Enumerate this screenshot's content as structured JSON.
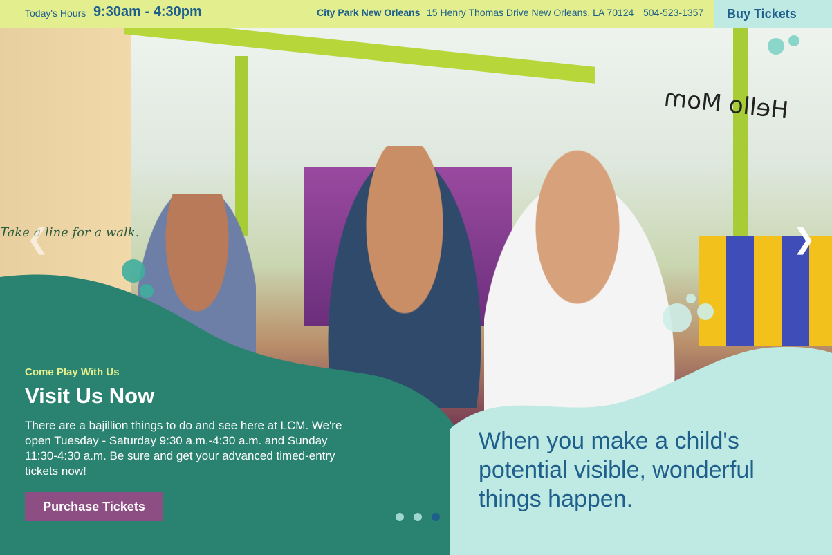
{
  "topbar": {
    "hours_label": "Today's Hours",
    "hours": "9:30am - 4:30pm",
    "location_name": "City Park New Orleans",
    "address": "15 Henry Thomas Drive New Orleans, LA 70124",
    "phone": "504-523-1357",
    "buy_label": "Buy Tickets"
  },
  "hero": {
    "photo_sign_text": "Take a line for a walk.",
    "photo_drawing_text": "Hello Mom",
    "eyebrow": "Come Play With Us",
    "title": "Visit Us Now",
    "description": "There are a bajillion things to do and see here at LCM. We're open Tuesday - Saturday 9:30 a.m.-4:30 a.m. and Sunday 11:30-4:30 a.m. Be sure and get your advanced timed-entry tickets now!",
    "purchase_label": "Purchase Tickets",
    "tagline": "When you make a child's potential visible, wonderful things happen.",
    "prev_icon": "chevron-left-icon",
    "next_icon": "chevron-right-icon",
    "slides": 3,
    "active_slide": 3
  },
  "colors": {
    "topbar_bg": "#e3ef8f",
    "buy_bg": "#bfe9e3",
    "brand_blue": "#1e5f8c",
    "green_wave": "#2a8270",
    "mint_wave": "#bfe9e3",
    "purchase_bg": "#8d4f83"
  }
}
